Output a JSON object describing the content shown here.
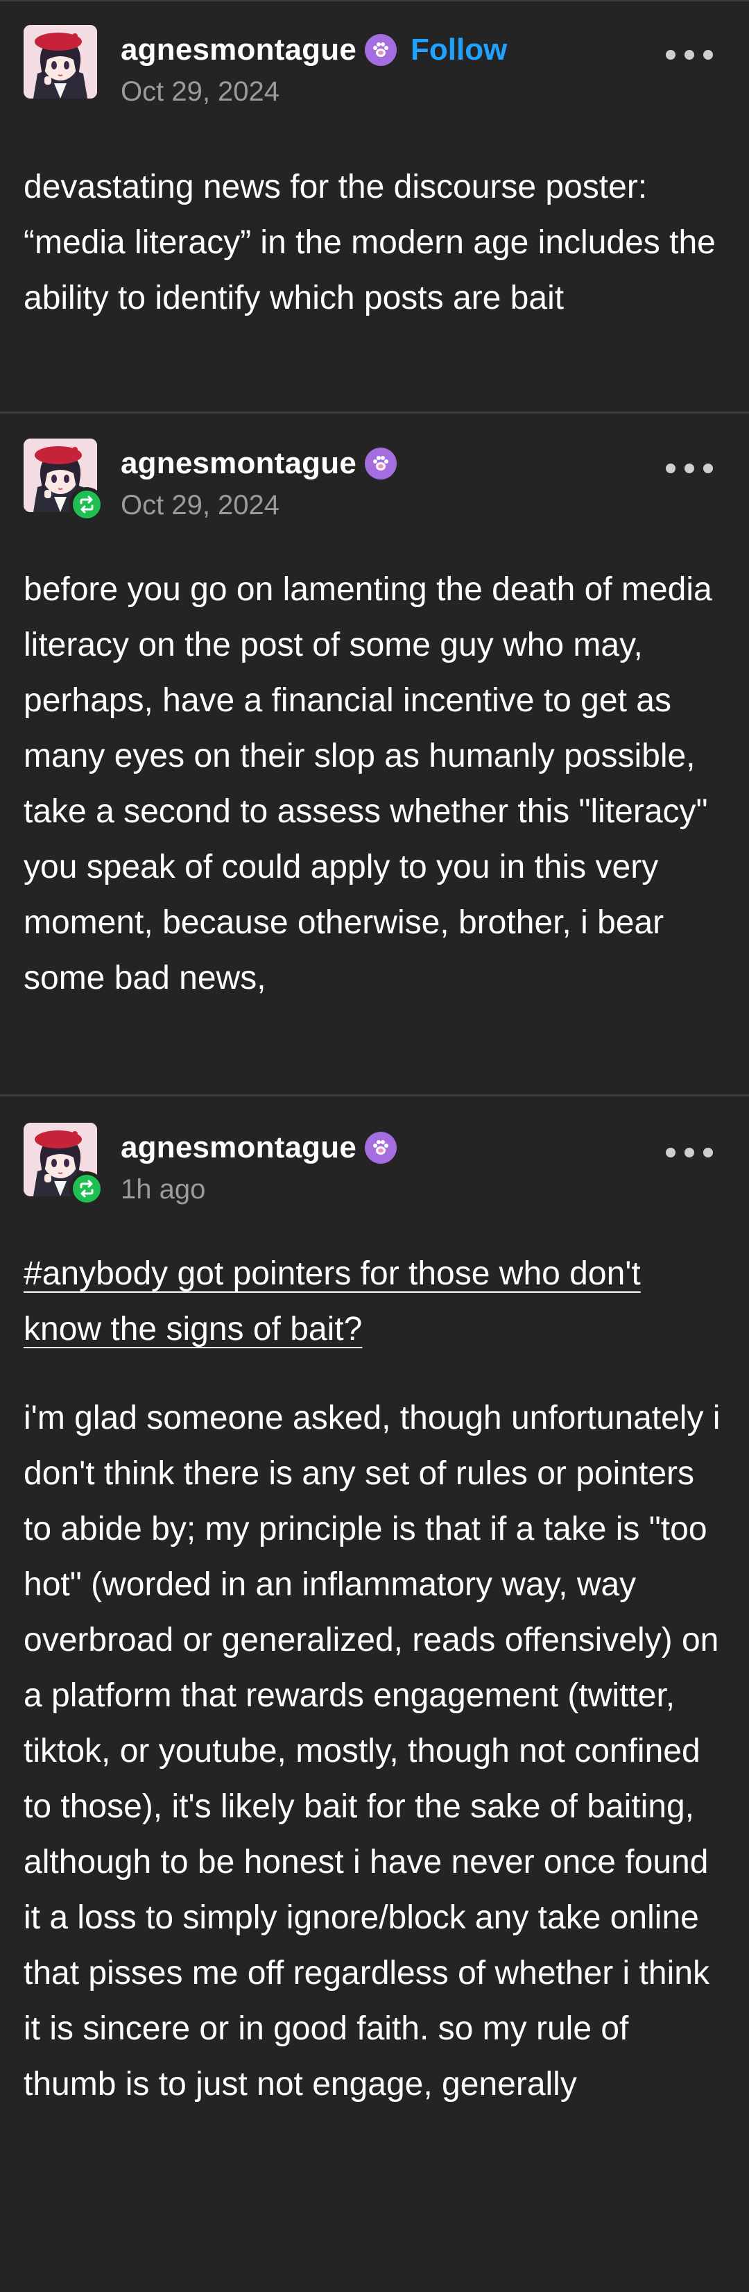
{
  "posts": [
    {
      "username": "agnesmontague",
      "follow_label": "Follow",
      "date": "Oct 29, 2024",
      "body": "devastating news for the discourse poster: “media literacy” in the modern age includes the ability to identify which posts are bait"
    },
    {
      "username": "agnesmontague",
      "date": "Oct 29, 2024",
      "body": "before you go on lamenting the death of media literacy on the post of some guy who may, perhaps, have a financial incentive to get as many eyes on their slop as humanly possible, take a second to assess whether this \"literacy\" you speak of could apply to you in this very moment, because otherwise, brother, i bear some bad news,"
    },
    {
      "username": "agnesmontague",
      "date": "1h ago",
      "tag": "#anybody got pointers for those who don't know the signs of bait?",
      "body": "i'm glad someone asked, though unfortunately i don't think there is any set of rules or pointers to abide by; my principle is that if a take is \"too hot\" (worded in an inflammatory way, way overbroad or generalized, reads offensively) on a platform that rewards engagement (twitter, tiktok, or youtube, mostly, though not confined to those), it's likely bait for the sake of baiting, although to be honest i have never once found it a loss to simply ignore/block any take online that pisses me off regardless of whether i think it is sincere or in good faith. so my rule of thumb is to just not engage, generally"
    }
  ],
  "icons": {
    "more": "more-options-icon",
    "verified": "paw-badge-icon",
    "reblog": "reblog-icon"
  },
  "colors": {
    "background": "#242424",
    "follow": "#1fa3ff",
    "badge": "#a46de0",
    "reblog": "#1fbf52",
    "muted": "#9b9b9b"
  }
}
